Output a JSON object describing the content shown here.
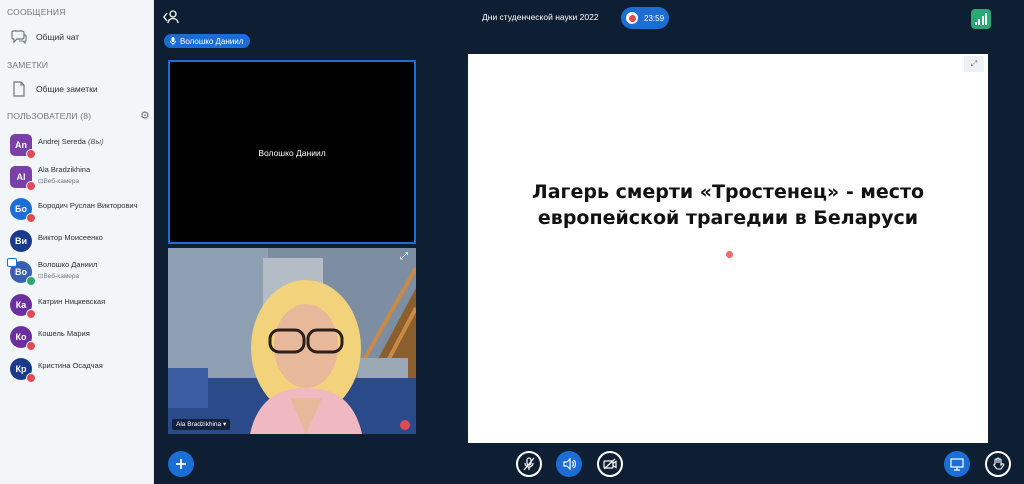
{
  "sidebar": {
    "messages_title": "СООБЩЕНИЯ",
    "public_chat": "Общий чат",
    "notes_title": "ЗАМЕТКИ",
    "shared_notes": "Общие заметки",
    "users_title": "ПОЛЬЗОВАТЕЛИ (8)",
    "users": [
      {
        "initials": "An",
        "name": "Andrej Sereda",
        "you": "(Вы)",
        "sub": "",
        "color": "#7b3fa8",
        "shape": "square",
        "status": "muted"
      },
      {
        "initials": "Al",
        "name": "Ala Bradzikhina",
        "sub": "Веб-камера",
        "color": "#7b3fa8",
        "shape": "square",
        "status": "muted"
      },
      {
        "initials": "Бо",
        "name": "Бородич Руслан Викторович",
        "sub": "",
        "color": "#1b6ed6",
        "shape": "round",
        "status": "muted"
      },
      {
        "initials": "Ви",
        "name": "Виктор Моисеенко",
        "sub": "",
        "color": "#1a3a8c",
        "shape": "round",
        "status": ""
      },
      {
        "initials": "Во",
        "name": "Волошко Даниил",
        "sub": "Веб-камера",
        "color": "#3a5fae",
        "shape": "round",
        "status": "presenter"
      },
      {
        "initials": "Ка",
        "name": "Катрин Ницкевская",
        "sub": "",
        "color": "#6b2fa0",
        "shape": "round",
        "status": "muted"
      },
      {
        "initials": "Ко",
        "name": "Кошель Мария",
        "sub": "",
        "color": "#6b2fa0",
        "shape": "round",
        "status": "muted"
      },
      {
        "initials": "Кр",
        "name": "Кристина Осадчая",
        "sub": "",
        "color": "#1a3a8c",
        "shape": "round",
        "status": "muted"
      }
    ]
  },
  "header": {
    "meeting_title": "Дни студенческой науки 2022",
    "record_time": "23:59",
    "talking_user": "Волошко Даниил"
  },
  "videos": {
    "tile1_name": "Волошко Даниил",
    "tile2_name": "Ala Bradzikhina"
  },
  "presentation": {
    "slide_title_line1": "Лагерь смерти «Тростенец» - место",
    "slide_title_line2": "европейской трагедии в Беларуси"
  },
  "icons": {
    "chat": "chat-bubble-icon",
    "notes": "document-icon",
    "settings": "gear-icon",
    "back": "user-back-icon",
    "connection": "signal-bars-icon",
    "add": "plus-icon",
    "mic": "mic-off-icon",
    "audio": "speaker-icon",
    "camera": "camera-off-icon",
    "presentation": "screen-icon",
    "raise_hand": "hand-icon"
  },
  "colors": {
    "accent": "#1b6ed6",
    "background": "#0f1f33",
    "muted": "#e14b55",
    "connection_ok": "#2aa876"
  }
}
